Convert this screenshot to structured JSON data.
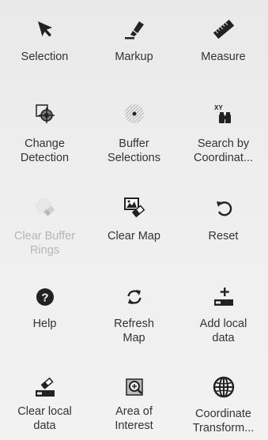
{
  "tools": [
    {
      "id": "selection",
      "label": "Selection",
      "icon": "cursor-arrow-icon",
      "enabled": true
    },
    {
      "id": "markup",
      "label": "Markup",
      "icon": "marker-pen-icon",
      "enabled": true
    },
    {
      "id": "measure",
      "label": "Measure",
      "icon": "ruler-icon",
      "enabled": true
    },
    {
      "id": "change-detection",
      "label": "Change\nDetection",
      "icon": "change-detection-icon",
      "enabled": true
    },
    {
      "id": "buffer-selections",
      "label": "Buffer\nSelections",
      "icon": "buffer-rings-icon",
      "enabled": true
    },
    {
      "id": "search-by-coordinates",
      "label": "Search by\nCoordinat...",
      "icon": "xy-binoculars-icon",
      "enabled": true
    },
    {
      "id": "clear-buffer-rings",
      "label": "Clear Buffer\nRings",
      "icon": "clear-buffer-icon",
      "enabled": false
    },
    {
      "id": "clear-map",
      "label": "Clear Map",
      "icon": "clear-map-icon",
      "enabled": true
    },
    {
      "id": "reset",
      "label": "Reset",
      "icon": "reset-arrow-icon",
      "enabled": true
    },
    {
      "id": "help",
      "label": "Help",
      "icon": "help-icon",
      "enabled": true
    },
    {
      "id": "refresh-map",
      "label": "Refresh\nMap",
      "icon": "refresh-icon",
      "enabled": true
    },
    {
      "id": "add-local-data",
      "label": "Add local\ndata",
      "icon": "add-data-icon",
      "enabled": true
    },
    {
      "id": "clear-local-data",
      "label": "Clear local\ndata",
      "icon": "clear-local-data-icon",
      "enabled": true
    },
    {
      "id": "area-of-interest",
      "label": "Area of\nInterest",
      "icon": "area-zoom-icon",
      "enabled": true
    },
    {
      "id": "coordinate-transform",
      "label": "Coordinate\nTransform...",
      "icon": "globe-icon",
      "enabled": true
    }
  ],
  "colors": {
    "icon": "#222222",
    "text": "#333333",
    "disabled": "#b5b5b5",
    "background": "#ededed"
  }
}
